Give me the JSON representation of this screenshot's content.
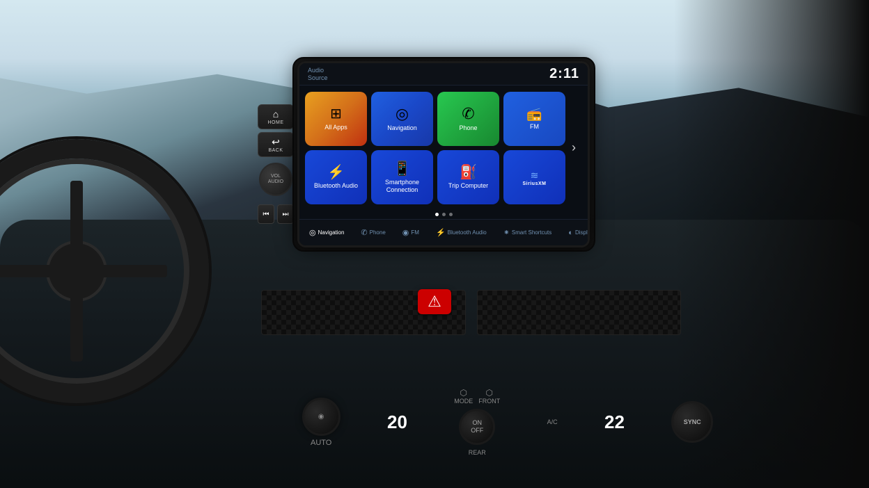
{
  "background": {
    "sky_color": "#c8dce8",
    "dash_color": "#1a1a1a"
  },
  "screen": {
    "header": {
      "audio_source_line1": "Audio",
      "audio_source_line2": "Source",
      "time": "2:11"
    },
    "app_grid": {
      "tiles": [
        {
          "id": "all-apps",
          "label": "All Apps",
          "icon": "⊞",
          "color_class": "tile-allapps"
        },
        {
          "id": "navigation",
          "label": "Navigation",
          "icon": "◎",
          "color_class": "tile-navigation"
        },
        {
          "id": "phone",
          "label": "Phone",
          "icon": "✆",
          "color_class": "tile-phone"
        },
        {
          "id": "fm",
          "label": "FM",
          "icon": "📡",
          "color_class": "tile-fm"
        },
        {
          "id": "bluetooth",
          "label": "Bluetooth Audio",
          "icon": "⚡",
          "color_class": "tile-bluetooth"
        },
        {
          "id": "smartphone",
          "label": "Smartphone Connection",
          "icon": "📱",
          "color_class": "tile-smartphone"
        },
        {
          "id": "trip-computer",
          "label": "Trip Computer",
          "icon": "⛽",
          "color_class": "tile-tripcomputer"
        },
        {
          "id": "siriusxm",
          "label": "SiriusXM",
          "icon": "◉",
          "color_class": "tile-siriusxm"
        }
      ],
      "dots": [
        {
          "active": true
        },
        {
          "active": false
        },
        {
          "active": false
        }
      ]
    },
    "bottom_nav": [
      {
        "icon": "◎",
        "label": "Navigation",
        "active": true
      },
      {
        "icon": "✆",
        "label": "Phone",
        "active": false
      },
      {
        "icon": "◉",
        "label": "FM",
        "active": false
      },
      {
        "icon": "⚡",
        "label": "Bluetooth Audio",
        "active": false
      },
      {
        "icon": "☀",
        "label": "Smart Shortcuts",
        "active": false
      },
      {
        "icon": "◐",
        "label": "Display Mode",
        "active": false
      }
    ]
  },
  "physical_controls": {
    "home_label": "HOME",
    "back_label": "BACK",
    "vol_audio_label": "VOL\nAUDIO"
  },
  "climate": {
    "temp_left": "20",
    "temp_right": "22",
    "auto_label": "AUTO",
    "ac_label": "A/C",
    "sync_label": "SYNC",
    "mode_label": "MODE",
    "front_label": "FRONT",
    "rear_label": "REAR",
    "on_off_label": "ON\nOFF"
  }
}
